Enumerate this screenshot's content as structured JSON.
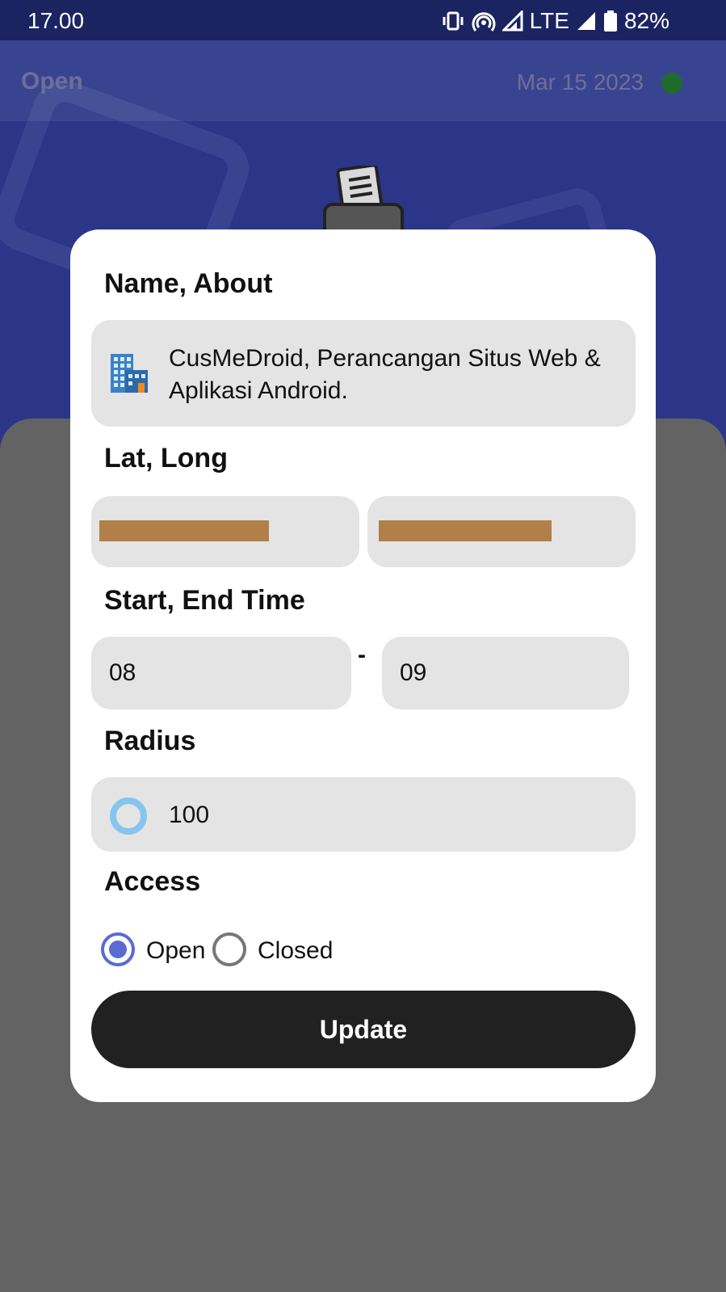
{
  "status_bar": {
    "time": "17.00",
    "network": "LTE",
    "battery": "82%"
  },
  "header": {
    "status": "Open",
    "date": "Mar 15 2023",
    "status_dot_color": "#1f6b2b"
  },
  "dialog": {
    "name_label": "Name, About",
    "name_value": "CusMeDroid, Perancangan Situs Web & Aplikasi Android.",
    "latlong_label": "Lat, Long",
    "time_label": "Start, End Time",
    "start_time": "08",
    "time_separator": "-",
    "end_time": "09",
    "radius_label": "Radius",
    "radius_value": "100",
    "access_label": "Access",
    "access_options": [
      "Open",
      "Closed"
    ],
    "access_selected": "Open",
    "update_button": "Update"
  },
  "colors": {
    "primary_dark": "#212121",
    "radio_accent": "#5a6bd1",
    "redaction": "#b17f47"
  }
}
